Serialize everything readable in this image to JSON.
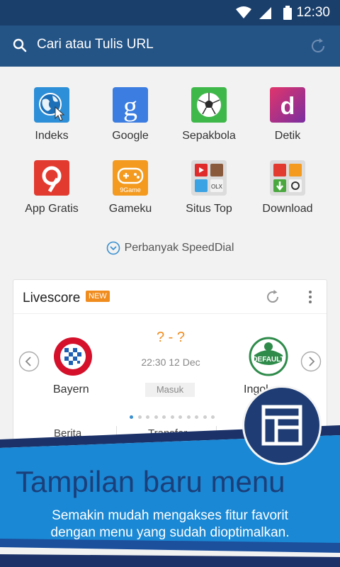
{
  "status_bar": {
    "time": "12:30",
    "icons": [
      "wifi-icon",
      "signal-icon",
      "battery-icon"
    ]
  },
  "url_bar": {
    "text": "Cari atau Tulis URL",
    "icons": [
      "search-icon",
      "reload-icon"
    ]
  },
  "speed_dial": [
    {
      "label": "Indeks",
      "icon": "globe-icon",
      "color": "#2d8fd8"
    },
    {
      "label": "Google",
      "icon": "google-icon",
      "color": "#3b7de0"
    },
    {
      "label": "Sepakbola",
      "icon": "soccer-ball-icon",
      "color": "#3fb84a"
    },
    {
      "label": "Detik",
      "icon": "detik-icon",
      "color": "#c8336f"
    },
    {
      "label": "App Gratis",
      "icon": "app-gratis-icon",
      "color": "#e23a2f"
    },
    {
      "label": "Gameku",
      "icon": "gamepad-icon",
      "color": "#f39a1f",
      "sublabel": "9Game"
    },
    {
      "label": "Situs Top",
      "icon": "site-grid-icon",
      "color": "#dcdcdc"
    },
    {
      "label": "Download",
      "icon": "download-grid-icon",
      "color": "#dcdcdc"
    }
  ],
  "more_speeddial": "Perbanyak SpeedDial",
  "livescore": {
    "title": "Livescore",
    "badge": "NEW",
    "home_team": "Bayern",
    "away_team": "Ingol",
    "score": "? - ?",
    "time": "22:30 12 Dec",
    "status": "Masuk",
    "away_crest_text": "DEFAULT",
    "pages": 11,
    "active_page": 1,
    "tabs": [
      "Berita",
      "Transfer"
    ]
  },
  "banner": {
    "headline": "Tampilan baru menu",
    "subtext_line1": "Semakin mudah mengakses fitur favorit",
    "subtext_line2": "dengan menu yang sudah dioptimalkan.",
    "colors": {
      "dark": "#1b3168",
      "blue": "#1a88d4",
      "light": "#5aa7e3"
    }
  }
}
